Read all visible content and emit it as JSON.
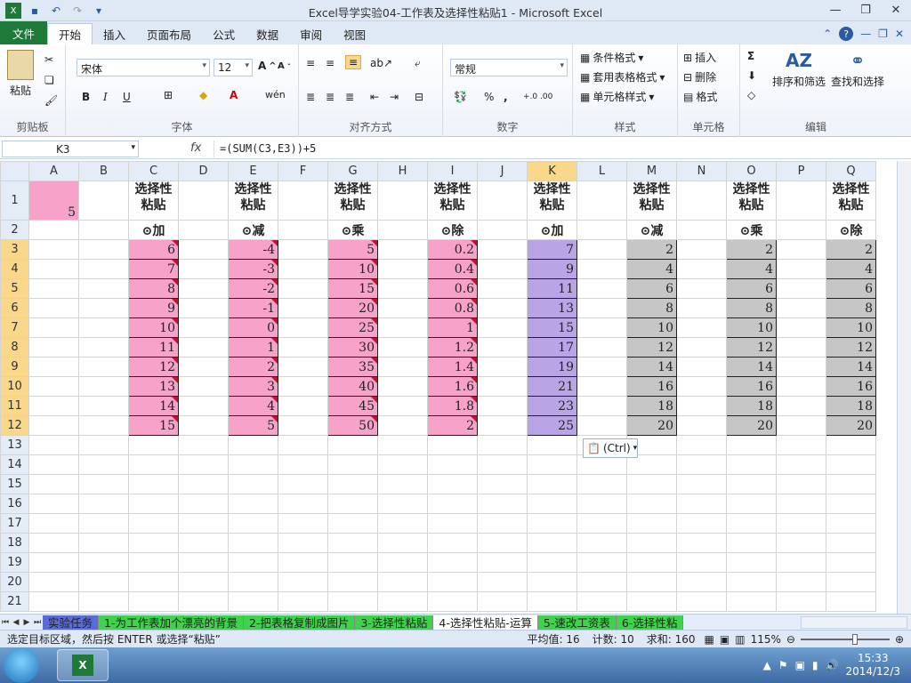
{
  "window": {
    "title": "Excel导学实验04-工作表及选择性粘贴1 - Microsoft Excel"
  },
  "ribbon_tabs": [
    "文件",
    "开始",
    "插入",
    "页面布局",
    "公式",
    "数据",
    "审阅",
    "视图"
  ],
  "ribbon": {
    "clipboard": {
      "paste": "粘贴",
      "label": "剪贴板"
    },
    "font": {
      "name": "宋体",
      "size": "12",
      "label": "字体",
      "bold": "B",
      "italic": "I",
      "underline": "U",
      "wen": "wén"
    },
    "alignment": {
      "label": "对齐方式"
    },
    "number": {
      "format": "常规",
      "label": "数字",
      "percent": "%",
      "comma": ",",
      "inc": "+.0 .00",
      "dec": ".00 +.0"
    },
    "styles": {
      "cond": "条件格式",
      "table": "套用表格格式",
      "cell": "单元格样式",
      "label": "样式"
    },
    "cells": {
      "insert": "插入",
      "delete": "删除",
      "format": "格式",
      "label": "单元格"
    },
    "editing": {
      "sigma": "Σ",
      "sort": "排序和筛选",
      "find": "查找和选择",
      "label": "编辑"
    }
  },
  "formula_bar": {
    "name_box": "K3",
    "fx": "fx",
    "formula": "=(SUM(C3,E3))+5"
  },
  "columns": [
    "A",
    "B",
    "C",
    "D",
    "E",
    "F",
    "G",
    "H",
    "I",
    "J",
    "K",
    "L",
    "M",
    "N",
    "O",
    "P",
    "Q"
  ],
  "rows": [
    1,
    2,
    3,
    4,
    5,
    6,
    7,
    8,
    9,
    10,
    11,
    12,
    13,
    14,
    15,
    16,
    17,
    18,
    19,
    20,
    21
  ],
  "cells": {
    "A1": "5",
    "headers": {
      "C": "选择性粘贴",
      "E": "选择性粘贴",
      "G": "选择性粘贴",
      "I": "选择性粘贴",
      "K": "选择性粘贴",
      "M": "选择性粘贴",
      "O": "选择性粘贴",
      "Q": "选择性粘贴"
    },
    "ops": {
      "C": "⊙加",
      "E": "⊙减",
      "G": "⊙乘",
      "I": "⊙除",
      "K": "⊙加",
      "M": "⊙减",
      "O": "⊙乘",
      "Q": "⊙除"
    },
    "C": [
      "6",
      "7",
      "8",
      "9",
      "10",
      "11",
      "12",
      "13",
      "14",
      "15"
    ],
    "E": [
      "-4",
      "-3",
      "-2",
      "-1",
      "0",
      "1",
      "2",
      "3",
      "4",
      "5"
    ],
    "G": [
      "5",
      "10",
      "15",
      "20",
      "25",
      "30",
      "35",
      "40",
      "45",
      "50"
    ],
    "I": [
      "0.2",
      "0.4",
      "0.6",
      "0.8",
      "1",
      "1.2",
      "1.4",
      "1.6",
      "1.8",
      "2"
    ],
    "K": [
      "7",
      "9",
      "11",
      "13",
      "15",
      "17",
      "19",
      "21",
      "23",
      "25"
    ],
    "M": [
      "2",
      "4",
      "6",
      "8",
      "10",
      "12",
      "14",
      "16",
      "18",
      "20"
    ],
    "O": [
      "2",
      "4",
      "6",
      "8",
      "10",
      "12",
      "14",
      "16",
      "18",
      "20"
    ],
    "Q": [
      "2",
      "4",
      "6",
      "8",
      "10",
      "12",
      "14",
      "16",
      "18",
      "20"
    ]
  },
  "paste_options": "(Ctrl)",
  "sheet_tabs": [
    "实验任务",
    "1-为工作表加个漂亮的背景",
    "2-把表格复制成图片",
    "3-选择性粘贴",
    "4-选择性粘贴-运算",
    "5-速改工资表",
    "6-选择性粘"
  ],
  "active_sheet_index": 4,
  "status": {
    "message": "选定目标区域，然后按 ENTER 或选择“粘贴”",
    "average": "平均值: 16",
    "count": "计数: 10",
    "sum": "求和: 160",
    "zoom": "115%"
  },
  "taskbar": {
    "time": "15:33",
    "date": "2014/12/3"
  },
  "colors": {
    "pink": "#f7a3c9",
    "purple": "#b9a5e6",
    "gray": "#c6c6c6",
    "file_tab": "#1f7a3a"
  }
}
